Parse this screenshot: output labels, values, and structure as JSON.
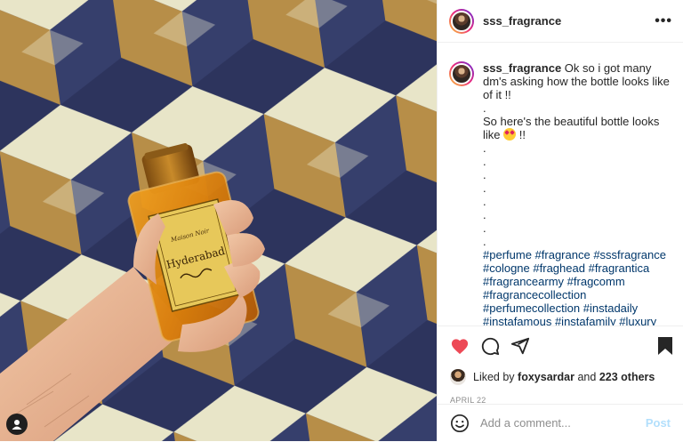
{
  "header": {
    "username": "sss_fragrance",
    "more_icon": "more-horizontal-icon"
  },
  "caption": {
    "username": "sss_fragrance",
    "line1": "Ok so i got many dm's asking how the bottle looks like of it !!",
    "dot": ".",
    "line2_before_emoji": "So here's the beautiful bottle looks like",
    "emoji": "heart-eyes-emoji",
    "line2_after_emoji": " !!",
    "hashtags": [
      "#perfume",
      "#fragrance",
      "#sssfragrance",
      "#cologne",
      "#fraghead",
      "#fragrantica",
      "#fragrancearmy",
      "#fragcomm",
      "#fragrancecollection",
      "#perfumecollection",
      "#instadaily",
      "#instafamous",
      "#instafamily",
      "#luxury"
    ]
  },
  "photo": {
    "bottle_label_top": "Hyderabad",
    "user_tag_icon": "user-tag-icon"
  },
  "actions": {
    "like_icon": "heart-filled-icon",
    "like_color": "#ed4956",
    "comment_icon": "comment-icon",
    "share_icon": "paper-plane-icon",
    "save_icon": "bookmark-filled-icon"
  },
  "likes": {
    "prefix": "Liked by ",
    "user": "foxysardar",
    "middle": " and ",
    "others": "223 others"
  },
  "date": "APRIL 22",
  "comment": {
    "placeholder": "Add a comment...",
    "post_label": "Post",
    "emoji_icon": "smiley-icon"
  }
}
